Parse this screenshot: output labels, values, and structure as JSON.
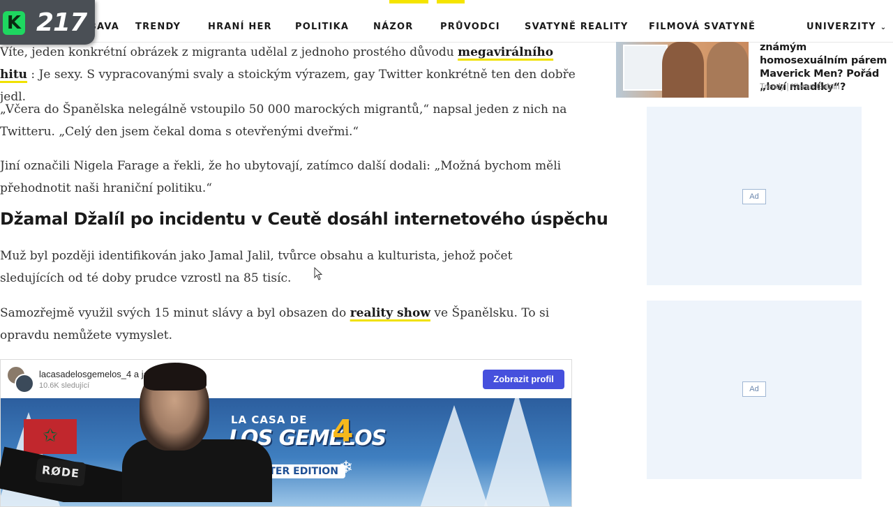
{
  "nav": {
    "items": [
      "ZÁBAVA",
      "TRENDY",
      "HRANÍ HER",
      "POLITIKA",
      "NÁZOR",
      "PRŮVODCI",
      "SVATYNĚ REALITY",
      "FILMOVÁ SVATYNĚ"
    ],
    "right_item": "UNIVERZITY",
    "accent_color": "#f5e400"
  },
  "stream_badge": {
    "letter": "K",
    "count": "217"
  },
  "article": {
    "p1_pre": "Víte, jeden konkrétní obrázek z migranta udělal z jednoho prostého důvodu ",
    "p1_link": "megavirálního hitu",
    "p1_post": " : Je sexy. S vypracovanými svaly a stoickým výrazem, gay Twitter konkrétně ten den dobře jedl.",
    "p2": "„Včera do Španělska nelegálně vstoupilo 50 000 marockých migrantů,“ napsal jeden z nich na Twitteru. „Celý den jsem čekal doma s otevřenými dveřmi.“",
    "p3": "Jiní označili Nigela Farage a řekli, že ho ubytovají, zatímco další dodali: „Možná bychom měli přehodnotit naši hraniční politiku.“",
    "heading": "Džamal Džalíl po incidentu v Ceutě dosáhl internetového úspěchu",
    "p4": "Muž byl později identifikován jako Jamal Jalil, tvůrce obsahu a kulturista, jehož počet sledujících od té doby prudce vzrostl na 85 tisíc.",
    "p5_pre": "Samozřejmě využil svých 15 minut slávy a byl obsazen do ",
    "p5_link": "reality show",
    "p5_post": " ve Španělsku. To si opravdu nemůžete vymyslet."
  },
  "embed": {
    "username": "lacasadelosgemelos_4",
    "username_suffix": "a ja...00",
    "followers": "10.6K sledující",
    "button": "Zobrazit profil",
    "logo_top": "LA CASA DE",
    "logo_main": "LOS GEMELOS",
    "logo_num": "4",
    "logo_sub": "WINTER EDITION"
  },
  "webcam": {
    "mic_brand": "RØDE"
  },
  "sidebar": {
    "card_title": "známým homosexuálním párem Maverick Men? Pořád „loví mladíky“?",
    "card_meta": "Trendy | Kieran Galpin",
    "ad_label": "Ad"
  }
}
